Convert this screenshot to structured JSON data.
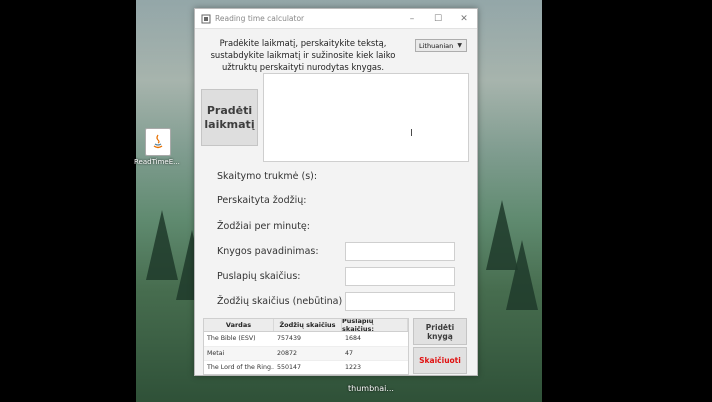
{
  "window": {
    "title": "Reading time calculator"
  },
  "instructions": "Pradėkite laikmatį, perskaitykite tekstą, sustabdykite laikmatį ir sužinosite kiek laiko užtruktų perskaityti nurodytas knygas.",
  "language": {
    "selected": "Lithuanian"
  },
  "buttons": {
    "start": "Pradėti laikmatį",
    "add_book": "Pridėti knygą",
    "calculate": "Skaičiuoti"
  },
  "labels": {
    "reading_duration": "Skaitymo trukmė (s):",
    "words_read": "Perskaityta žodžių:",
    "words_per_minute": "Žodžiai per minutę:",
    "book_name": "Knygos pavadinimas:",
    "page_count": "Puslapių skaičius:",
    "word_count": "Žodžių skaičius (nebūtina)"
  },
  "table": {
    "headers": [
      "Vardas",
      "Žodžių skaičius",
      "Puslapių skaičius:"
    ],
    "rows": [
      [
        "The Bible (ESV)",
        "757439",
        "1684"
      ],
      [
        "Metai",
        "20872",
        "47"
      ],
      [
        "The Lord of the Ring...",
        "550147",
        "1223"
      ]
    ]
  },
  "desktop": {
    "icon_label": "ReadTimeE...",
    "bottom_label": "thumbnai..."
  },
  "colors": {
    "accent_red": "#e01010"
  }
}
